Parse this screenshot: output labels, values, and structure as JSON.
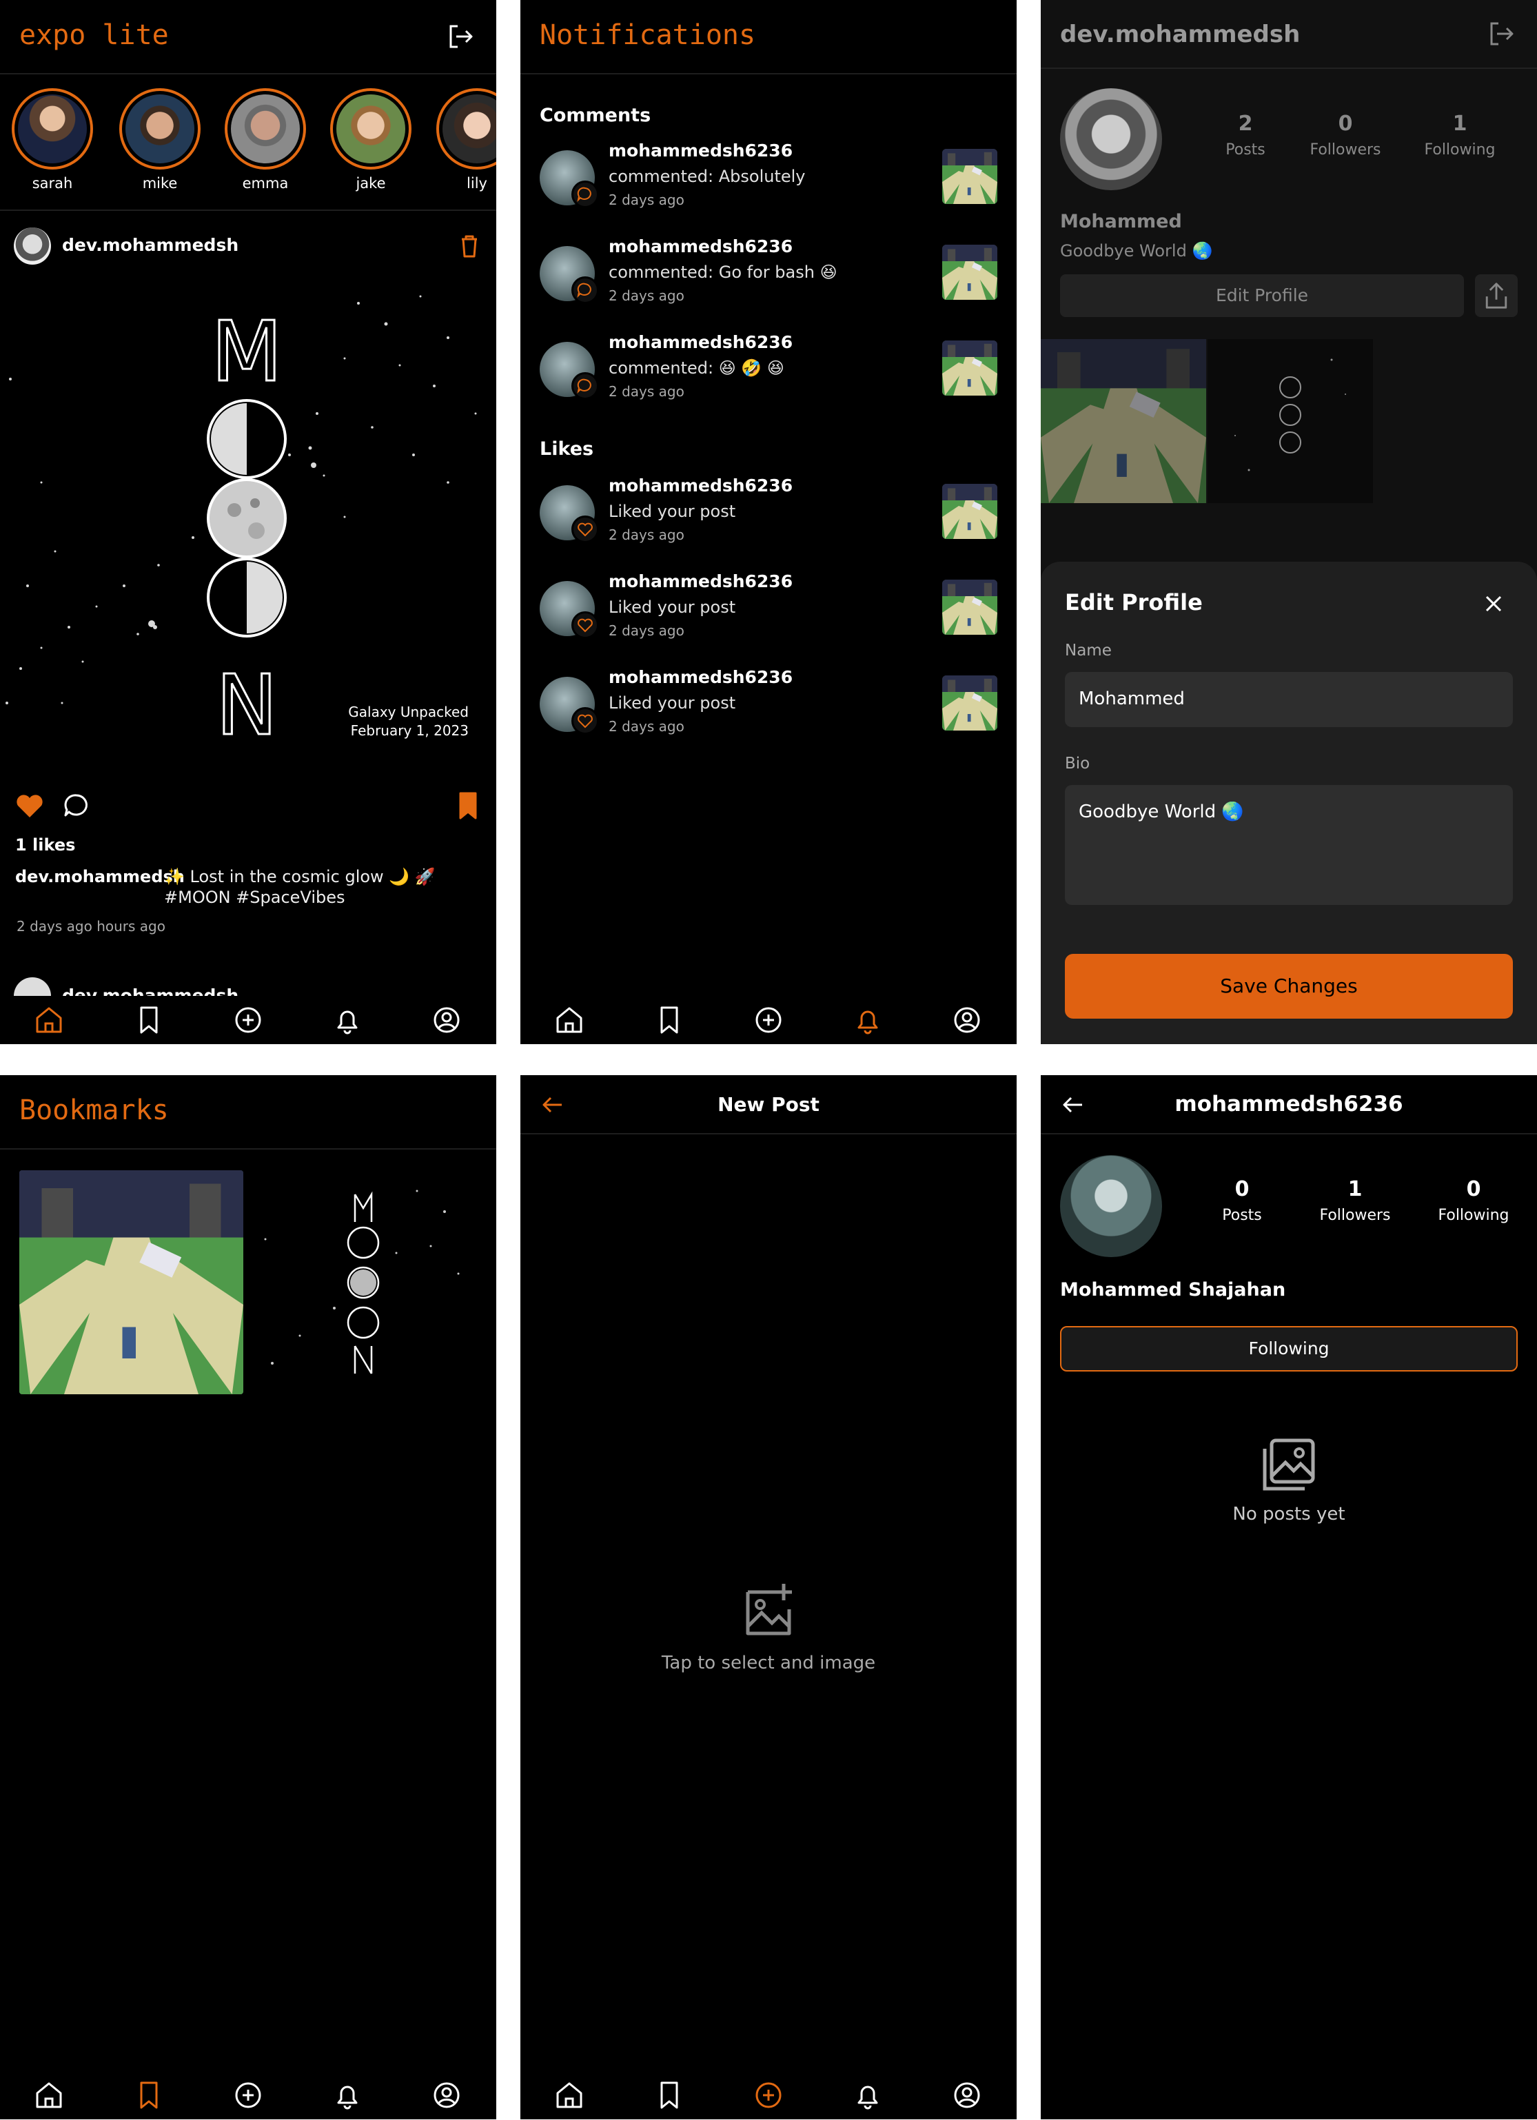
{
  "colors": {
    "accent": "#e36a12",
    "bg": "#000000",
    "sheet": "#1f1f1f"
  },
  "home": {
    "title": "expo lite",
    "stories": [
      {
        "name": "sarah"
      },
      {
        "name": "mike"
      },
      {
        "name": "emma"
      },
      {
        "name": "jake"
      },
      {
        "name": "lily"
      }
    ],
    "post": {
      "username": "dev.mohammedsh",
      "image_letters": [
        "M",
        "N"
      ],
      "image_caption_line1": "Galaxy Unpacked",
      "image_caption_line2": "February 1, 2023",
      "likes": "1 likes",
      "caption_user": "dev.mohammedsh",
      "caption_text": "✨ Lost in the cosmic glow 🌙 🚀",
      "caption_tags": "#MOON #SpaceVibes",
      "time": "2 days ago hours ago",
      "liked": true,
      "bookmarked": true
    },
    "next_post_username": "dev.mohammedsh"
  },
  "notifications": {
    "title": "Notifications",
    "comments_heading": "Comments",
    "likes_heading": "Likes",
    "comments": [
      {
        "user": "mohammedsh6236",
        "text": "commented: Absolutely",
        "time": "2 days ago"
      },
      {
        "user": "mohammedsh6236",
        "text": "commented: Go for bash 😆",
        "time": "2 days ago"
      },
      {
        "user": "mohammedsh6236",
        "text": "commented: 😆 🤣 😆",
        "time": "2 days ago"
      }
    ],
    "likes": [
      {
        "user": "mohammedsh6236",
        "text": "Liked your post",
        "time": "2 days ago"
      },
      {
        "user": "mohammedsh6236",
        "text": "Liked your post",
        "time": "2 days ago"
      },
      {
        "user": "mohammedsh6236",
        "text": "Liked your post",
        "time": "2 days ago"
      }
    ]
  },
  "profile": {
    "username": "dev.mohammedsh",
    "posts": "2",
    "posts_label": "Posts",
    "followers": "0",
    "followers_label": "Followers",
    "following": "1",
    "following_label": "Following",
    "name": "Mohammed",
    "bio": "Goodbye World 🌏",
    "edit_button": "Edit Profile",
    "sheet": {
      "title": "Edit Profile",
      "name_label": "Name",
      "name_value": "Mohammed",
      "bio_label": "Bio",
      "bio_value": "Goodbye World 🌏",
      "save_button": "Save Changes"
    }
  },
  "bookmarks": {
    "title": "Bookmarks"
  },
  "new_post": {
    "title": "New Post",
    "hint": "Tap to select and image"
  },
  "user_profile": {
    "username": "mohammedsh6236",
    "posts": "0",
    "posts_label": "Posts",
    "followers": "1",
    "followers_label": "Followers",
    "following": "0",
    "following_label": "Following",
    "name": "Mohammed Shajahan",
    "follow_button": "Following",
    "empty_text": "No posts yet"
  },
  "tabs": [
    "home",
    "bookmarks",
    "create",
    "notifications",
    "profile"
  ],
  "active_tabs": {
    "home": "home",
    "notifications": "notifications",
    "bookmarks": "bookmarks",
    "new_post": "create"
  }
}
